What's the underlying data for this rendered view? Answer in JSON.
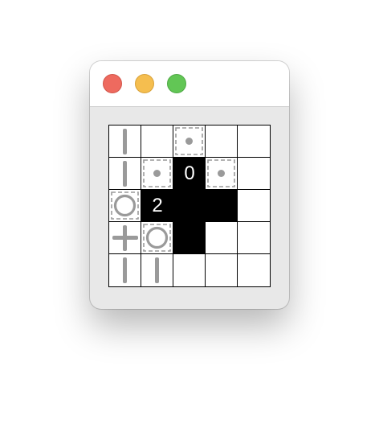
{
  "window": {
    "controls": [
      {
        "name": "close-button",
        "color": "#ee6a5f",
        "border": "#d2554a"
      },
      {
        "name": "minimize-button",
        "color": "#f5be4f",
        "border": "#d8a23a"
      },
      {
        "name": "maximize-button",
        "color": "#62c655",
        "border": "#4fa945"
      }
    ]
  },
  "puzzle": {
    "rows": 5,
    "cols": 5,
    "colors": {
      "shaded": "#000000",
      "empty": "#ffffff",
      "glyph": "#9a9a9a",
      "number": "#ffffff"
    },
    "cells": [
      [
        {
          "type": "line-v"
        },
        {
          "type": "empty"
        },
        {
          "type": "dot"
        },
        {
          "type": "empty"
        },
        {
          "type": "empty"
        }
      ],
      [
        {
          "type": "line-v"
        },
        {
          "type": "dot"
        },
        {
          "type": "number",
          "value": "0"
        },
        {
          "type": "dot"
        },
        {
          "type": "empty"
        }
      ],
      [
        {
          "type": "circle"
        },
        {
          "type": "number",
          "value": "2"
        },
        {
          "type": "black"
        },
        {
          "type": "black"
        },
        {
          "type": "empty"
        }
      ],
      [
        {
          "type": "cross"
        },
        {
          "type": "circle"
        },
        {
          "type": "black"
        },
        {
          "type": "empty"
        },
        {
          "type": "empty"
        }
      ],
      [
        {
          "type": "line-v"
        },
        {
          "type": "line-v"
        },
        {
          "type": "empty"
        },
        {
          "type": "empty"
        },
        {
          "type": "empty"
        }
      ]
    ]
  }
}
